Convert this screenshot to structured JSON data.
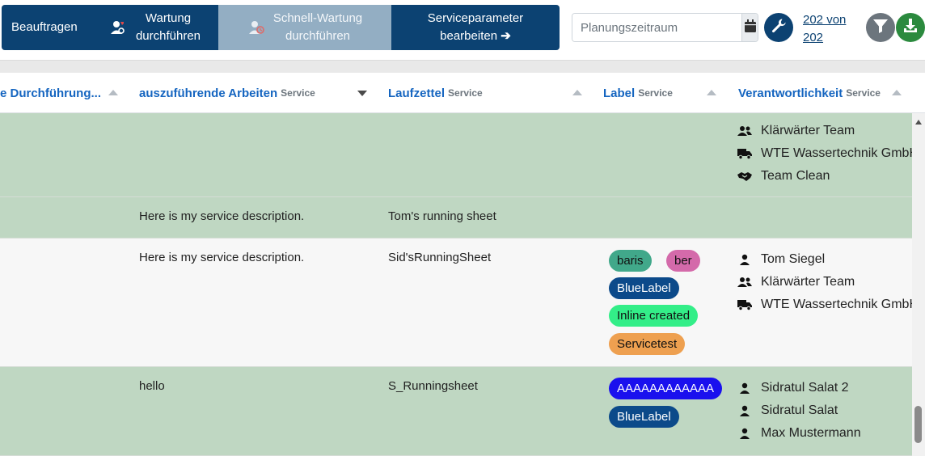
{
  "toolbar": {
    "beauftragen_label": "Beauftragen",
    "wartung_line1": "Wartung",
    "wartung_line2": "durchführen",
    "schnell_line1": "Schnell-Wartung",
    "schnell_line2": "durchführen",
    "serviceparam_line1": "Serviceparameter",
    "serviceparam_line2": "bearbeiten",
    "serviceparam_arrow": "➔",
    "date_placeholder": "Planungszeitraum",
    "count_line1": "202 von",
    "count_line2": "202",
    "icons": [
      "wartung-icon",
      "schnell-wartung-icon",
      "calendar-icon",
      "wrench-icon",
      "filter-icon",
      "download-icon"
    ]
  },
  "table": {
    "headers": [
      {
        "label": "e Durchführung...",
        "sub": "",
        "sort": "up"
      },
      {
        "label": "auszuführende Arbeiten",
        "sub": "Service",
        "sort": "down"
      },
      {
        "label": "Laufzettel",
        "sub": "Service",
        "sort": "up"
      },
      {
        "label": "Label",
        "sub": "Service",
        "sort": "up"
      },
      {
        "label": "Verantwortlichkeit",
        "sub": "Service",
        "sort": "up"
      }
    ],
    "rows": [
      {
        "arbeiten": "",
        "laufzettel": "",
        "labels": [],
        "responsibles": [
          {
            "icon": "users-icon",
            "name": "Klärwärter Team"
          },
          {
            "icon": "truck-icon",
            "name": "WTE Wassertechnik GmbH"
          },
          {
            "icon": "handshake-icon",
            "name": "Team Clean"
          }
        ]
      },
      {
        "arbeiten": "Here is my service description.",
        "laufzettel": "Tom's running sheet",
        "labels": [],
        "responsibles": []
      },
      {
        "arbeiten": "Here is my service description.",
        "laufzettel": "Sid'sRunningSheet",
        "labels": [
          {
            "text": "baris",
            "bg": "#41a88a",
            "fg": "#111111"
          },
          {
            "text": "ber",
            "bg": "#d46aaa",
            "fg": "#111111"
          },
          {
            "text": "BlueLabel",
            "bg": "#0c4a8a",
            "fg": "#ffffff"
          },
          {
            "text": "Inline created",
            "bg": "#33ee88",
            "fg": "#111111"
          },
          {
            "text": "Servicetest",
            "bg": "#eea050",
            "fg": "#111111"
          }
        ],
        "responsibles": [
          {
            "icon": "user-icon",
            "name": "Tom Siegel"
          },
          {
            "icon": "users-icon",
            "name": "Klärwärter Team"
          },
          {
            "icon": "truck-icon",
            "name": "WTE Wassertechnik GmbH"
          }
        ]
      },
      {
        "arbeiten": "hello",
        "laufzettel": "S_Runningsheet",
        "labels": [
          {
            "text": "AAAAAAAAAAAA",
            "bg": "#1a10ee",
            "fg": "#ffffff"
          },
          {
            "text": "BlueLabel",
            "bg": "#0c4a8a",
            "fg": "#ffffff"
          }
        ],
        "responsibles": [
          {
            "icon": "user-icon",
            "name": "Sidratul Salat 2"
          },
          {
            "icon": "user-icon",
            "name": "Sidratul Salat"
          },
          {
            "icon": "user-icon",
            "name": "Max Mustermann"
          }
        ]
      }
    ]
  },
  "colors": {
    "primary": "#0c4272",
    "primary_disabled": "#93aec3",
    "header_link": "#1565c0",
    "row_green": "#bfd7c2",
    "row_white": "#f7f7f7",
    "download_green": "#2b8a3e",
    "filter_grey": "#6c757d"
  }
}
